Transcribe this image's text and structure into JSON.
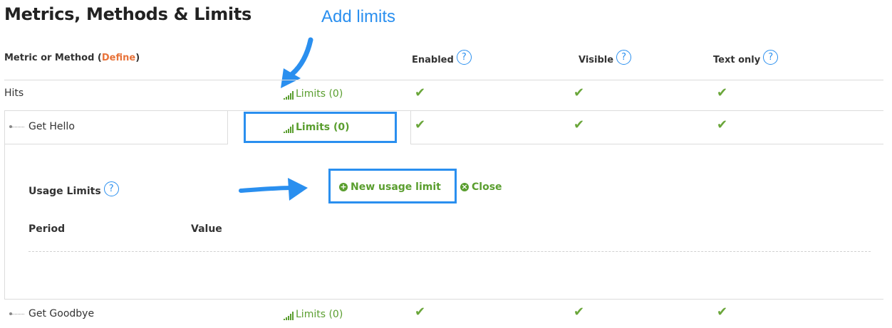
{
  "page": {
    "title": "Metrics, Methods & Limits",
    "annotation": "Add limits"
  },
  "header": {
    "metric_label": "Metric or Method (",
    "define_label": "Define",
    "close_paren": ")",
    "enabled": "Enabled",
    "visible": "Visible",
    "text_only": "Text only",
    "help_glyph": "?"
  },
  "rows": [
    {
      "label": "Hits",
      "limits": "Limits (0)",
      "enabled": "✔",
      "visible": "✔",
      "text_only": "✔"
    },
    {
      "label": "Get Hello",
      "limits": "Limits (0)",
      "enabled": "✔",
      "visible": "✔",
      "text_only": "✔"
    },
    {
      "label": "Get Goodbye",
      "limits": "Limits (0)",
      "enabled": "✔",
      "visible": "✔",
      "text_only": "✔"
    }
  ],
  "usage_panel": {
    "title": "Usage Limits",
    "new_limit": "New usage limit",
    "close": "Close",
    "columns": [
      "Period",
      "Value"
    ]
  },
  "colors": {
    "link_green": "#5a9e2f",
    "define_orange": "#e8733a",
    "annotation_blue": "#2a8fef",
    "check_green": "#6aa63a"
  },
  "icons": {
    "help": "question-circle-icon",
    "limits": "signal-bars-icon",
    "check": "check-icon",
    "new": "plus-circle-icon",
    "close": "close-circle-icon",
    "arrow": "annotation-arrow-icon"
  }
}
